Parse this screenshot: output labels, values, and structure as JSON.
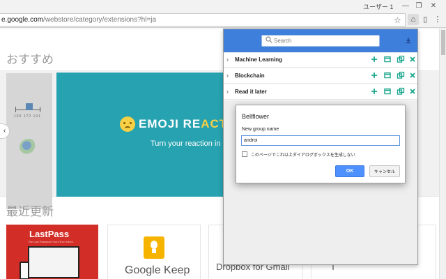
{
  "window": {
    "user_label": "ユーザー 1",
    "minimize": "—",
    "restore": "❐",
    "close": "✕"
  },
  "omnibox": {
    "url_host": "e.google.com",
    "url_path": "/webstore/category/extensions?hl=ja"
  },
  "store": {
    "featured_title": "おすすめ",
    "recent_title": "最近更新",
    "mini_ticks": "150  172  191",
    "banner_title_main": "EMOJI RE",
    "banner_title_accent": "ACTIO",
    "banner_subtitle": "Turn your reaction in",
    "carousel_prev": "‹",
    "cards": [
      {
        "name": "LastPass",
        "tagline": "The Last Password You'll Ever Need."
      },
      {
        "name": "Google Keep"
      },
      {
        "name": "Dropbox for Gmail"
      }
    ]
  },
  "popup": {
    "search_placeholder": "Search",
    "groups": [
      {
        "name": "Machine Learning"
      },
      {
        "name": "Blockchain"
      },
      {
        "name": "Read it later"
      }
    ],
    "action_color": "#16a58a",
    "header_color": "#3f7fdc"
  },
  "dialog": {
    "title": "Bellflower",
    "label": "New group name",
    "input_value": "androi",
    "checkbox_label": "このページでこれ以上ダイアログボックスを生成しない",
    "ok_label": "OK",
    "cancel_label": "キャンセル"
  }
}
